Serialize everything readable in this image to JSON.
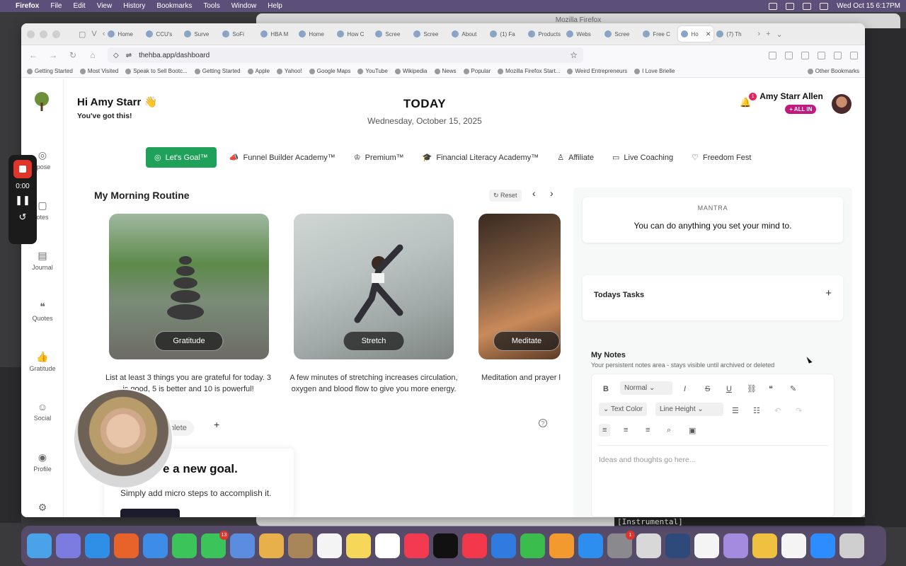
{
  "menubar": {
    "app": "Firefox",
    "items": [
      "File",
      "Edit",
      "View",
      "History",
      "Bookmarks",
      "Tools",
      "Window",
      "Help"
    ],
    "datetime": "Wed Oct 15  6:17PM"
  },
  "bg_window_title": "Mozilla Firefox",
  "lyric": "[Instrumental]",
  "browser": {
    "tabs": [
      "Home",
      "CCU's",
      "Surve",
      "SoFi",
      "HBA M",
      "Home",
      "How C",
      "Scree",
      "Scree",
      "About",
      "(1) Fa",
      "Products",
      "Webs",
      "Scree",
      "Free C",
      "Ho",
      "(7) Th"
    ],
    "url": "thehba.app/dashboard",
    "bookmarks": [
      "Getting Started",
      "Most Visited",
      "Speak to Sell Bootc...",
      "Getting Started",
      "Apple",
      "Yahoo!",
      "Google Maps",
      "YouTube",
      "Wikipedia",
      "News",
      "Popular",
      "Mozilla Firefox Start...",
      "Weird Entrepreneurs",
      "I Love Brielle"
    ],
    "other_bookmarks": "Other Bookmarks"
  },
  "sidenav": {
    "items": [
      {
        "label": "rpose",
        "icon": "target-icon"
      },
      {
        "label": "otes",
        "icon": "notes-icon"
      },
      {
        "label": "Journal",
        "icon": "book-icon"
      },
      {
        "label": "Quotes",
        "icon": "quote-icon"
      },
      {
        "label": "Gratitude",
        "icon": "thumbs-up-icon"
      },
      {
        "label": "Social",
        "icon": "people-icon"
      },
      {
        "label": "Profile",
        "icon": "profile-icon"
      }
    ]
  },
  "header": {
    "greeting": "Hi Amy Starr 👋",
    "subgreeting": "You've got this!",
    "today": "TODAY",
    "date": "Wednesday, October 15, 2025",
    "notif_count": "1",
    "user_name": "Amy Starr Allen",
    "badge": "+ ALL IN"
  },
  "navtabs": [
    {
      "label": "Let's Goal™",
      "icon": "target-icon"
    },
    {
      "label": "Funnel Builder Academy™",
      "icon": "megaphone-icon"
    },
    {
      "label": "Premium™",
      "icon": "crown-icon"
    },
    {
      "label": "Financial Literacy Academy™",
      "icon": "graduation-cap-icon"
    },
    {
      "label": "Affiliate",
      "icon": "user-icon"
    },
    {
      "label": "Live Coaching",
      "icon": "video-icon"
    },
    {
      "label": "Freedom Fest",
      "icon": "heart-icon"
    }
  ],
  "routine": {
    "title": "My Morning Routine",
    "reset": "Reset",
    "cards": [
      {
        "label": "Gratitude",
        "desc": "List at least 3 things you are grateful for today. 3 is good, 5 is better and 10 is powerful!"
      },
      {
        "label": "Stretch",
        "desc": "A few minutes of stretching increases circulation, oxygen and blood flow to give you more energy."
      },
      {
        "label": "Meditate",
        "desc": "Meditation and prayer l connection to y"
      }
    ]
  },
  "goal": {
    "complete": "plete",
    "heading": "e a new goal.",
    "sub": "Simply add micro steps to accomplish it."
  },
  "panel": {
    "mantra_label": "MANTRA",
    "mantra_text": "You can do anything you set your mind to.",
    "tasks_label": "Todays Tasks",
    "notes_title": "My Notes",
    "notes_sub": "Your persistent notes area - stays visible until archived or deleted",
    "format_select": "Normal",
    "text_color": "Text Color",
    "line_height": "Line Height",
    "placeholder": "Ideas and thoughts go here..."
  },
  "recorder": {
    "time": "0:00"
  },
  "dock": {
    "messages_badge": "13",
    "settings_badge": "1"
  },
  "colors": {
    "accent": "#1fa15a",
    "badge": "#c2187f",
    "record": "#e0352b"
  }
}
